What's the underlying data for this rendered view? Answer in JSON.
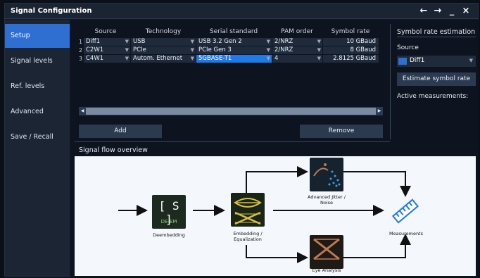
{
  "window": {
    "title": "Signal Configuration",
    "controls": [
      "←",
      "→",
      "_",
      "×"
    ]
  },
  "sidebar": {
    "items": [
      {
        "label": "Setup"
      },
      {
        "label": "Signal levels"
      },
      {
        "label": "Ref. levels"
      },
      {
        "label": "Advanced"
      },
      {
        "label": "Save / Recall"
      }
    ]
  },
  "table": {
    "headers": [
      "Source",
      "Technology",
      "Serial standard",
      "PAM order",
      "Symbol rate"
    ],
    "rows": [
      {
        "num": "1",
        "source": "Diff1",
        "technology": "USB",
        "standard": "USB 3.2 Gen 2",
        "pam": "2/NRZ",
        "rate": "10 GBaud"
      },
      {
        "num": "2",
        "source": "C2W1",
        "technology": "PCIe",
        "standard": "PCIe Gen 3",
        "pam": "2/NRZ",
        "rate": "8 GBaud"
      },
      {
        "num": "3",
        "source": "C4W1",
        "technology": "Autom. Ethernet",
        "standard": "5GBASE-T1",
        "pam": "4",
        "rate": "2.8125 GBaud"
      }
    ]
  },
  "buttons": {
    "add": "Add",
    "remove": "Remove",
    "estimate": "Estimate symbol rate"
  },
  "estimation": {
    "title": "Symbol rate estimation",
    "source_label": "Source",
    "source_value": "Diff1",
    "active_label": "Active measurements:"
  },
  "flow": {
    "title": "Signal flow overview",
    "deembed_text": "DE-EM",
    "deembed_bracket": "[ S ]",
    "labels": {
      "deembedding": "Deembedding",
      "embedding": "Embedding / Equalization",
      "jitter": "Advanced Jitter / Noise",
      "eye": "Eye Analysis",
      "measurements": "Measurements"
    }
  },
  "colors": {
    "accent": "#2f6fd1",
    "selected": "#1e7ae6",
    "sidebar": "#1b2534",
    "flow_bg": "#f4f7fb",
    "eye_gold": "#d8c03a",
    "eye_copper": "#c07a52",
    "jitter_blue": "#3aa0e8"
  },
  "icons": [
    "arrow-left-icon",
    "arrow-right-icon",
    "minimize-icon",
    "close-icon",
    "dropdown-icon",
    "measurements-icon"
  ]
}
